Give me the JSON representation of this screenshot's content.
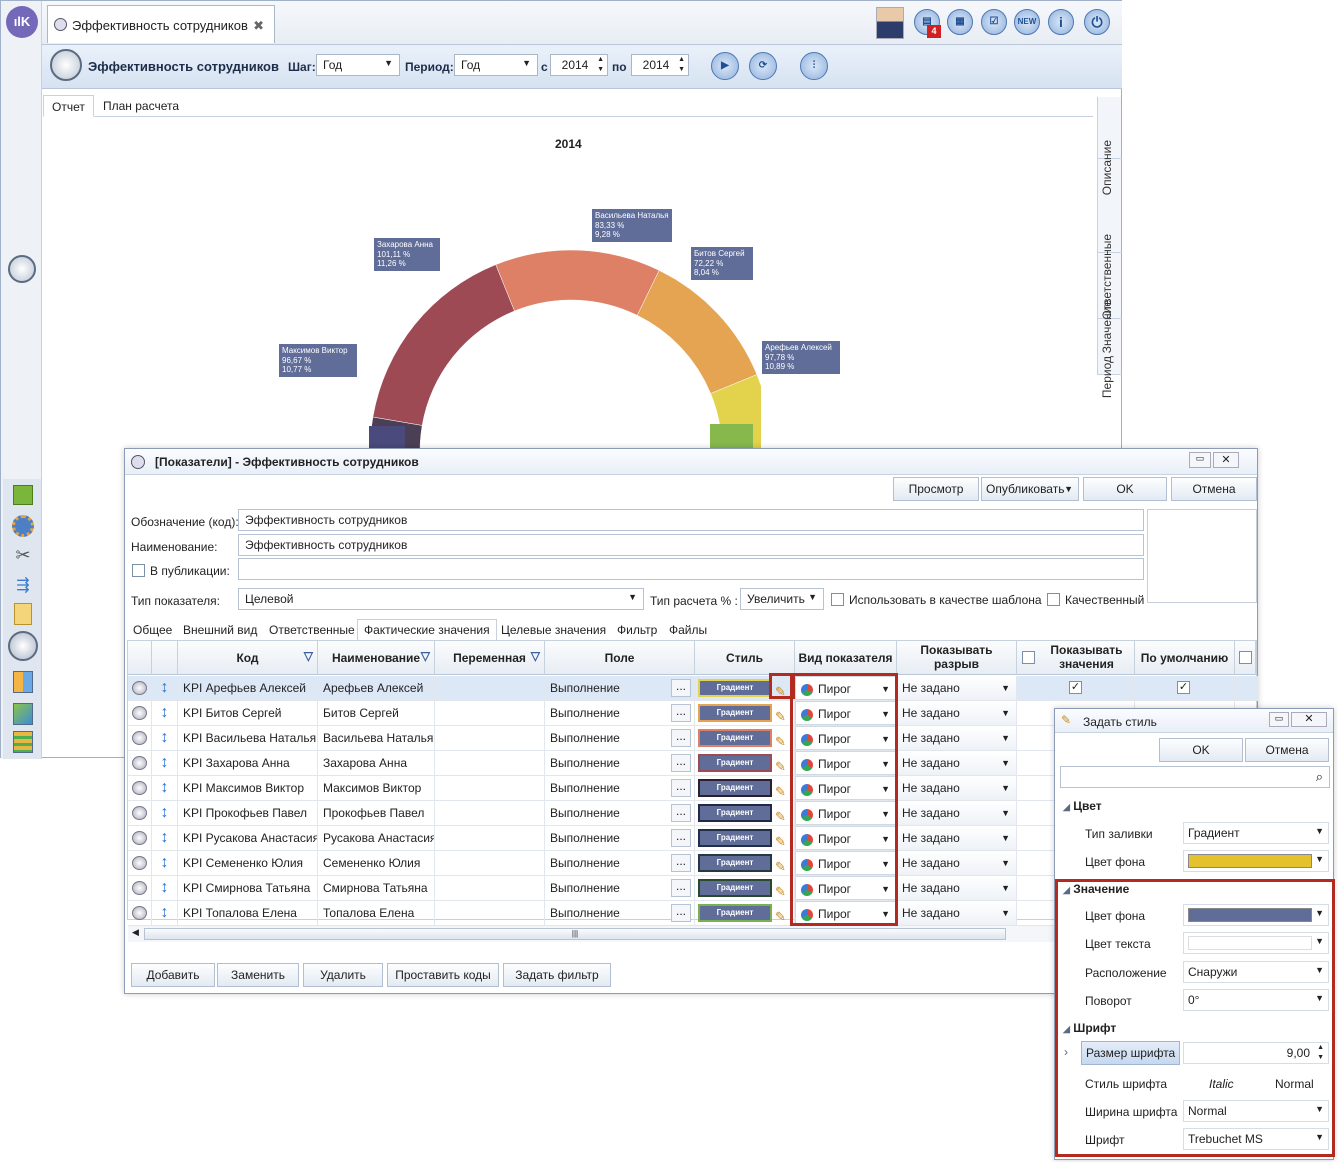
{
  "app": {
    "tab_title": "Эффективность сотрудников",
    "page_title": "Эффективность сотрудников",
    "notification_count": "4"
  },
  "toolbar": {
    "step_label": "Шаг:",
    "step_value": "Год",
    "period_label": "Период:",
    "period_value": "Год",
    "from_label": "с",
    "from_value": "2014",
    "to_label": "по",
    "to_value": "2014"
  },
  "report_tabs": [
    "Отчет",
    "План расчета"
  ],
  "side_tabs": [
    "Описание",
    "Ответственные",
    "Значение",
    "Период"
  ],
  "chart_data": {
    "type": "pie",
    "title": "2014",
    "slices": [
      {
        "name": "Васильева Наталья",
        "value_pct": "83,33 %",
        "share": "9,28 %",
        "share_num": 9.28,
        "color": "#dd8066"
      },
      {
        "name": "Битов Сергей",
        "value_pct": "72,22 %",
        "share": "8,04 %",
        "share_num": 8.04,
        "color": "#e4a452"
      },
      {
        "name": "Арефьев Алексей",
        "value_pct": "97,78 %",
        "share": "10,89 %",
        "share_num": 10.89,
        "color": "#e2d24c"
      },
      {
        "name": "Максимов Виктор",
        "value_pct": "96,67 %",
        "share": "10,77 %",
        "share_num": 10.77,
        "color": "#4b3f55"
      },
      {
        "name": "Захарова Анна",
        "value_pct": "101,11 %",
        "share": "11,26 %",
        "share_num": 11.26,
        "color": "#9e4a55"
      }
    ]
  },
  "dialog": {
    "title": "[Показатели] - Эффективность сотрудников",
    "buttons": {
      "preview": "Просмотр",
      "publish": "Опубликовать",
      "ok": "OK",
      "cancel": "Отмена"
    },
    "code_label": "Обозначение (код):",
    "code_value": "Эффективность сотрудников",
    "name_label": "Наименование:",
    "name_value": "Эффективность сотрудников",
    "pub_label": "В публикации:",
    "type_label": "Тип показателя:",
    "type_value": "Целевой",
    "calc_label": "Тип расчета % :",
    "calc_value": "Увеличить",
    "template_label": "Использовать в качестве шаблона",
    "quality_label": "Качественный",
    "tabs": [
      "Общее",
      "Внешний вид",
      "Ответственные",
      "Фактические значения",
      "Целевые значения",
      "Фильтр",
      "Файлы"
    ],
    "columns": {
      "code": "Код",
      "name": "Наименование",
      "var": "Переменная",
      "field": "Поле",
      "style": "Стиль",
      "kind": "Вид показателя",
      "gap": "Показывать разрыв",
      "show": "Показывать значения",
      "default": "По умолчанию"
    },
    "rows": [
      {
        "code": "KPI Арефьев Алексей",
        "name": "Арефьев Алексей",
        "field": "Выполнение",
        "style": "Градиент",
        "border": "#e2d24c",
        "kind": "Пирог",
        "gap": "Не задано"
      },
      {
        "code": "KPI Битов Сергей",
        "name": "Битов Сергей",
        "field": "Выполнение",
        "style": "Градиент",
        "border": "#e4a452",
        "kind": "Пирог",
        "gap": "Не задано"
      },
      {
        "code": "KPI Васильева Наталья",
        "name": "Васильева Наталья",
        "field": "Выполнение",
        "style": "Градиент",
        "border": "#dd8066",
        "kind": "Пирог",
        "gap": "Не задано"
      },
      {
        "code": "KPI Захарова Анна",
        "name": "Захарова Анна",
        "field": "Выполнение",
        "style": "Градиент",
        "border": "#9e4a55",
        "kind": "Пирог",
        "gap": "Не задано"
      },
      {
        "code": "KPI Максимов Виктор",
        "name": "Максимов Виктор",
        "field": "Выполнение",
        "style": "Градиент",
        "border": "#2a2030",
        "kind": "Пирог",
        "gap": "Не задано"
      },
      {
        "code": "KPI Прокофьев Павел",
        "name": "Прокофьев Павел",
        "field": "Выполнение",
        "style": "Градиент",
        "border": "#202a48",
        "kind": "Пирог",
        "gap": "Не задано"
      },
      {
        "code": "KPI Русакова Анастасия",
        "name": "Русакова Анастасия",
        "field": "Выполнение",
        "style": "Градиент",
        "border": "#203048",
        "kind": "Пирог",
        "gap": "Не задано"
      },
      {
        "code": "KPI Семененко Юлия",
        "name": "Семененко Юлия",
        "field": "Выполнение",
        "style": "Градиент",
        "border": "#233a40",
        "kind": "Пирог",
        "gap": "Не задано"
      },
      {
        "code": "KPI Смирнова Татьяна",
        "name": "Смирнова Татьяна",
        "field": "Выполнение",
        "style": "Градиент",
        "border": "#2a4a30",
        "kind": "Пирог",
        "gap": "Не задано"
      },
      {
        "code": "KPI Топалова Елена",
        "name": "Топалова Елена",
        "field": "Выполнение",
        "style": "Градиент",
        "border": "#7ab050",
        "kind": "Пирог",
        "gap": "Не задано"
      }
    ],
    "bottom": [
      "Добавить",
      "Заменить",
      "Удалить",
      "Проставить коды",
      "Задать фильтр"
    ]
  },
  "style_dialog": {
    "title": "Задать стиль",
    "ok": "OK",
    "cancel": "Отмена",
    "sec_color": "Цвет",
    "fill_type_label": "Тип заливки",
    "fill_type": "Градиент",
    "bg_label": "Цвет фона",
    "bg_color": "#e4c22e",
    "sec_value": "Значение",
    "v_bg_label": "Цвет фона",
    "v_bg_color": "#5f6d98",
    "v_text_label": "Цвет текста",
    "pos_label": "Расположение",
    "pos_value": "Снаружи",
    "rot_label": "Поворот",
    "rot_value": "0°",
    "sec_font": "Шрифт",
    "size_label": "Размер шрифта",
    "size_value": "9,00",
    "fstyle_label": "Стиль шрифта",
    "italic": "Italic",
    "normal": "Normal",
    "width_label": "Ширина шрифта",
    "width_value": "Normal",
    "font_label": "Шрифт",
    "font_value": "Trebuchet MS"
  }
}
